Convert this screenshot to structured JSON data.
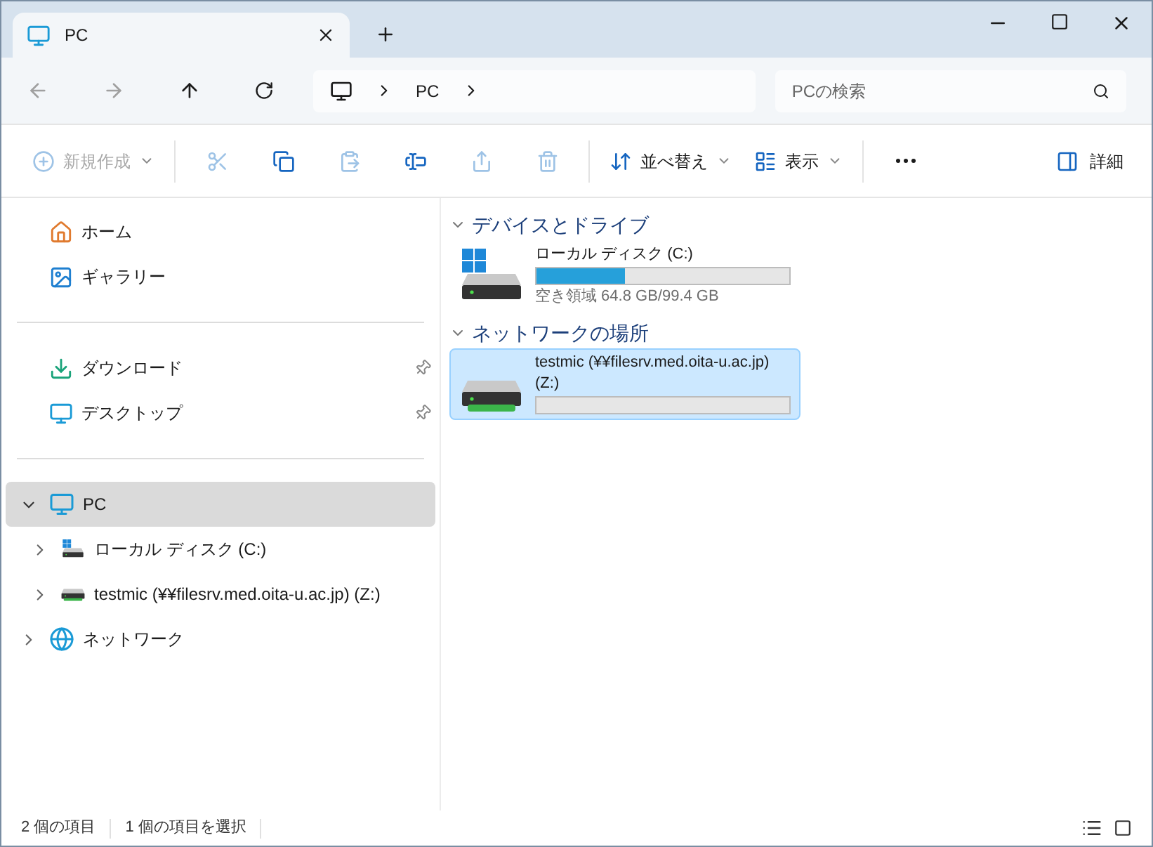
{
  "tab": {
    "title": "PC"
  },
  "address": {
    "breadcrumb": [
      "PC"
    ],
    "search_placeholder": "PCの検索"
  },
  "toolbar": [
    {
      "kind": "labeled",
      "label": "新規作成",
      "disabled": true,
      "dropdown": true
    },
    {
      "kind": "icon",
      "disabled": true
    },
    {
      "kind": "icon",
      "disabled": false
    },
    {
      "kind": "icon",
      "disabled": true
    },
    {
      "kind": "icon",
      "disabled": false
    },
    {
      "kind": "icon",
      "disabled": true
    },
    {
      "kind": "icon",
      "disabled": true
    },
    {
      "kind": "labeled",
      "label": "並べ替え",
      "disabled": false,
      "dropdown": true
    },
    {
      "kind": "labeled",
      "label": "表示",
      "disabled": false,
      "dropdown": true
    },
    {
      "kind": "icon",
      "disabled": false
    }
  ],
  "details_button": {
    "label": "詳細"
  },
  "nav": {
    "quick": [
      {
        "label": "ホーム",
        "pinned": false
      },
      {
        "label": "ギャラリー",
        "pinned": false
      }
    ],
    "pinned": [
      {
        "label": "ダウンロード",
        "pinned": true
      },
      {
        "label": "デスクトップ",
        "pinned": true
      }
    ],
    "tree": [
      {
        "label": "PC",
        "expanded": true,
        "selected": true,
        "children": [
          {
            "label": "ローカル ディスク (C:)",
            "expanded": false,
            "selected": false
          },
          {
            "label": "testmic (¥¥filesrv.med.oita-u.ac.jp) (Z:)",
            "expanded": false,
            "selected": false
          }
        ]
      },
      {
        "label": "ネットワーク",
        "expanded": false,
        "selected": false
      }
    ]
  },
  "groups": [
    {
      "title": "デバイスとドライブ",
      "expanded": true,
      "items": [
        {
          "kind": "local",
          "name": "ローカル ディスク (C:)",
          "level": 0.35,
          "detail": "空き領域 64.8 GB/99.4 GB",
          "selected": false
        }
      ]
    },
    {
      "title": "ネットワークの場所",
      "expanded": true,
      "items": [
        {
          "kind": "network",
          "name": "testmic (¥¥filesrv.med.oita-u.ac.jp) (Z:)",
          "selected": true
        }
      ]
    }
  ],
  "status_bar": {
    "count": "2 個の項目",
    "selection": "1 個の項目を選択"
  }
}
